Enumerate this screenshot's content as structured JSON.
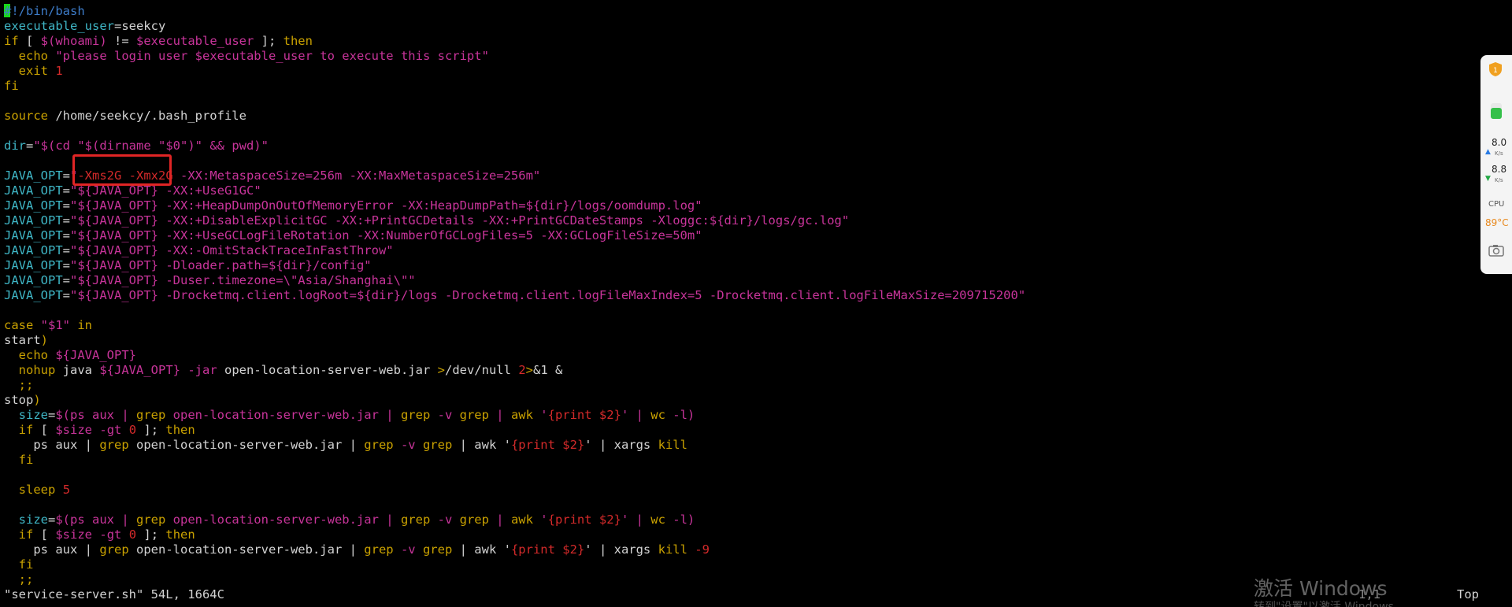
{
  "lines": [
    [
      [
        "comment",
        "#!/bin/bash"
      ]
    ],
    [
      [
        "var",
        "executable_user"
      ],
      [
        "plain",
        "=seekcy"
      ]
    ],
    [
      [
        "cmd",
        "if"
      ],
      [
        "plain",
        " [ "
      ],
      [
        "subst",
        "$(whoami)"
      ],
      [
        "plain",
        " != "
      ],
      [
        "subst",
        "$executable_user"
      ],
      [
        "plain",
        " ]; "
      ],
      [
        "cmd",
        "then"
      ]
    ],
    [
      [
        "plain",
        "  "
      ],
      [
        "cmd",
        "echo"
      ],
      [
        "plain",
        " "
      ],
      [
        "str",
        "\"please login user "
      ],
      [
        "subst",
        "$executable_user"
      ],
      [
        "str",
        " to execute this script\""
      ]
    ],
    [
      [
        "plain",
        "  "
      ],
      [
        "cmd",
        "exit"
      ],
      [
        "plain",
        " "
      ],
      [
        "num",
        "1"
      ]
    ],
    [
      [
        "cmd",
        "fi"
      ]
    ],
    [
      [
        "plain",
        ""
      ]
    ],
    [
      [
        "cmd",
        "source"
      ],
      [
        "plain",
        " /home/seekcy/.bash_profile"
      ]
    ],
    [
      [
        "plain",
        ""
      ]
    ],
    [
      [
        "var",
        "dir"
      ],
      [
        "plain",
        "="
      ],
      [
        "str",
        "\"$(cd \""
      ],
      [
        "subst",
        "$(dirname \"$0\")"
      ],
      [
        "str",
        "\" && pwd)\""
      ]
    ],
    [
      [
        "plain",
        ""
      ]
    ],
    [
      [
        "var",
        "JAVA_OPT"
      ],
      [
        "plain",
        "="
      ],
      [
        "str",
        "\""
      ],
      [
        "num",
        "-Xms2G -Xmx2G"
      ],
      [
        "str",
        " -XX:MetaspaceSize=256m -XX:MaxMetaspaceSize=256m\""
      ]
    ],
    [
      [
        "var",
        "JAVA_OPT"
      ],
      [
        "plain",
        "="
      ],
      [
        "str",
        "\""
      ],
      [
        "subst",
        "${JAVA_OPT}"
      ],
      [
        "str",
        " -XX:+UseG1GC\""
      ]
    ],
    [
      [
        "var",
        "JAVA_OPT"
      ],
      [
        "plain",
        "="
      ],
      [
        "str",
        "\""
      ],
      [
        "subst",
        "${JAVA_OPT}"
      ],
      [
        "str",
        " -XX:+HeapDumpOnOutOfMemoryError -XX:HeapDumpPath="
      ],
      [
        "subst",
        "${dir}"
      ],
      [
        "str",
        "/logs/oomdump.log\""
      ]
    ],
    [
      [
        "var",
        "JAVA_OPT"
      ],
      [
        "plain",
        "="
      ],
      [
        "str",
        "\""
      ],
      [
        "subst",
        "${JAVA_OPT}"
      ],
      [
        "str",
        " -XX:+DisableExplicitGC -XX:+PrintGCDetails -XX:+PrintGCDateStamps -Xloggc:"
      ],
      [
        "subst",
        "${dir}"
      ],
      [
        "str",
        "/logs/gc.log\""
      ]
    ],
    [
      [
        "var",
        "JAVA_OPT"
      ],
      [
        "plain",
        "="
      ],
      [
        "str",
        "\""
      ],
      [
        "subst",
        "${JAVA_OPT}"
      ],
      [
        "str",
        " -XX:+UseGCLogFileRotation -XX:NumberOfGCLogFiles=5 -XX:GCLogFileSize=50m\""
      ]
    ],
    [
      [
        "var",
        "JAVA_OPT"
      ],
      [
        "plain",
        "="
      ],
      [
        "str",
        "\""
      ],
      [
        "subst",
        "${JAVA_OPT}"
      ],
      [
        "str",
        " -XX:-OmitStackTraceInFastThrow\""
      ]
    ],
    [
      [
        "var",
        "JAVA_OPT"
      ],
      [
        "plain",
        "="
      ],
      [
        "str",
        "\""
      ],
      [
        "subst",
        "${JAVA_OPT}"
      ],
      [
        "str",
        " -Dloader.path="
      ],
      [
        "subst",
        "${dir}"
      ],
      [
        "str",
        "/config\""
      ]
    ],
    [
      [
        "var",
        "JAVA_OPT"
      ],
      [
        "plain",
        "="
      ],
      [
        "str",
        "\""
      ],
      [
        "subst",
        "${JAVA_OPT}"
      ],
      [
        "str",
        " -Duser.timezone=\\\"Asia/Shanghai\\\"\""
      ]
    ],
    [
      [
        "var",
        "JAVA_OPT"
      ],
      [
        "plain",
        "="
      ],
      [
        "str",
        "\""
      ],
      [
        "subst",
        "${JAVA_OPT}"
      ],
      [
        "str",
        " -Drocketmq.client.logRoot="
      ],
      [
        "subst",
        "${dir}"
      ],
      [
        "str",
        "/logs -Drocketmq.client.logFileMaxIndex=5 -Drocketmq.client.logFileMaxSize=209715200\""
      ]
    ],
    [
      [
        "plain",
        ""
      ]
    ],
    [
      [
        "cmd",
        "case"
      ],
      [
        "plain",
        " "
      ],
      [
        "str",
        "\"$1\""
      ],
      [
        "plain",
        " "
      ],
      [
        "cmd",
        "in"
      ]
    ],
    [
      [
        "plain",
        "start"
      ],
      [
        "cmd",
        ")"
      ]
    ],
    [
      [
        "plain",
        "  "
      ],
      [
        "cmd",
        "echo"
      ],
      [
        "plain",
        " "
      ],
      [
        "subst",
        "${JAVA_OPT}"
      ]
    ],
    [
      [
        "plain",
        "  "
      ],
      [
        "cmd",
        "nohup"
      ],
      [
        "plain",
        " java "
      ],
      [
        "subst",
        "${JAVA_OPT}"
      ],
      [
        "plain",
        " "
      ],
      [
        "opt",
        "-jar"
      ],
      [
        "plain",
        " open-location-server-web.jar "
      ],
      [
        "cmd",
        ">"
      ],
      [
        "plain",
        "/dev/null "
      ],
      [
        "num",
        "2"
      ],
      [
        "cmd",
        ">"
      ],
      [
        "plain",
        "&1 &"
      ]
    ],
    [
      [
        "plain",
        "  "
      ],
      [
        "cmd",
        ";;"
      ]
    ],
    [
      [
        "plain",
        "stop"
      ],
      [
        "cmd",
        ")"
      ]
    ],
    [
      [
        "plain",
        "  "
      ],
      [
        "var",
        "size"
      ],
      [
        "plain",
        "="
      ],
      [
        "subst",
        "$(ps aux | "
      ],
      [
        "cmd",
        "grep"
      ],
      [
        "subst",
        " open-location-server-web.jar | "
      ],
      [
        "cmd",
        "grep"
      ],
      [
        "subst",
        " -v "
      ],
      [
        "cmd",
        "grep"
      ],
      [
        "subst",
        " | "
      ],
      [
        "cmd",
        "awk"
      ],
      [
        "subst",
        " '"
      ],
      [
        "num",
        "{print $2}"
      ],
      [
        "subst",
        "' | "
      ],
      [
        "cmd",
        "wc"
      ],
      [
        "subst",
        " -l)"
      ]
    ],
    [
      [
        "plain",
        "  "
      ],
      [
        "cmd",
        "if"
      ],
      [
        "plain",
        " [ "
      ],
      [
        "subst",
        "$size"
      ],
      [
        "plain",
        " "
      ],
      [
        "opt",
        "-gt"
      ],
      [
        "plain",
        " "
      ],
      [
        "num",
        "0"
      ],
      [
        "plain",
        " ]; "
      ],
      [
        "cmd",
        "then"
      ]
    ],
    [
      [
        "plain",
        "    ps aux | "
      ],
      [
        "cmd",
        "grep"
      ],
      [
        "plain",
        " open-location-server-web.jar | "
      ],
      [
        "cmd",
        "grep"
      ],
      [
        "plain",
        " "
      ],
      [
        "opt",
        "-v"
      ],
      [
        "plain",
        " "
      ],
      [
        "cmd",
        "grep"
      ],
      [
        "plain",
        " | awk '"
      ],
      [
        "num",
        "{print $2}"
      ],
      [
        "plain",
        "' | xargs "
      ],
      [
        "cmd",
        "kill"
      ]
    ],
    [
      [
        "plain",
        "  "
      ],
      [
        "cmd",
        "fi"
      ]
    ],
    [
      [
        "plain",
        ""
      ]
    ],
    [
      [
        "plain",
        "  "
      ],
      [
        "cmd",
        "sleep"
      ],
      [
        "plain",
        " "
      ],
      [
        "num",
        "5"
      ]
    ],
    [
      [
        "plain",
        ""
      ]
    ],
    [
      [
        "plain",
        "  "
      ],
      [
        "var",
        "size"
      ],
      [
        "plain",
        "="
      ],
      [
        "subst",
        "$(ps aux | "
      ],
      [
        "cmd",
        "grep"
      ],
      [
        "subst",
        " open-location-server-web.jar | "
      ],
      [
        "cmd",
        "grep"
      ],
      [
        "subst",
        " -v "
      ],
      [
        "cmd",
        "grep"
      ],
      [
        "subst",
        " | "
      ],
      [
        "cmd",
        "awk"
      ],
      [
        "subst",
        " '"
      ],
      [
        "num",
        "{print $2}"
      ],
      [
        "subst",
        "' | "
      ],
      [
        "cmd",
        "wc"
      ],
      [
        "subst",
        " -l)"
      ]
    ],
    [
      [
        "plain",
        "  "
      ],
      [
        "cmd",
        "if"
      ],
      [
        "plain",
        " [ "
      ],
      [
        "subst",
        "$size"
      ],
      [
        "plain",
        " "
      ],
      [
        "opt",
        "-gt"
      ],
      [
        "plain",
        " "
      ],
      [
        "num",
        "0"
      ],
      [
        "plain",
        " ]; "
      ],
      [
        "cmd",
        "then"
      ]
    ],
    [
      [
        "plain",
        "    ps aux | "
      ],
      [
        "cmd",
        "grep"
      ],
      [
        "plain",
        " open-location-server-web.jar | "
      ],
      [
        "cmd",
        "grep"
      ],
      [
        "plain",
        " "
      ],
      [
        "opt",
        "-v"
      ],
      [
        "plain",
        " "
      ],
      [
        "cmd",
        "grep"
      ],
      [
        "plain",
        " | awk '"
      ],
      [
        "num",
        "{print $2}"
      ],
      [
        "plain",
        "' | xargs "
      ],
      [
        "cmd",
        "kill"
      ],
      [
        "plain",
        " "
      ],
      [
        "num",
        "-9"
      ]
    ],
    [
      [
        "plain",
        "  "
      ],
      [
        "cmd",
        "fi"
      ]
    ],
    [
      [
        "plain",
        "  "
      ],
      [
        "cmd",
        ";;"
      ]
    ]
  ],
  "status": {
    "file": "\"service-server.sh\" 54L, 1664C",
    "position": "1,1",
    "scroll": "Top"
  },
  "watermark": {
    "title": "激活 Windows",
    "subtitle": "转到\"设置\"以激活 Windows。"
  },
  "side_widget": {
    "upload": "8.0",
    "download": "8.8",
    "unit": "K/s",
    "cpu_label": "CPU",
    "cpu_value": "89°C"
  },
  "colors": {
    "background": "#000000",
    "highlight_box": "#e02525",
    "cursor": "#19d619"
  }
}
